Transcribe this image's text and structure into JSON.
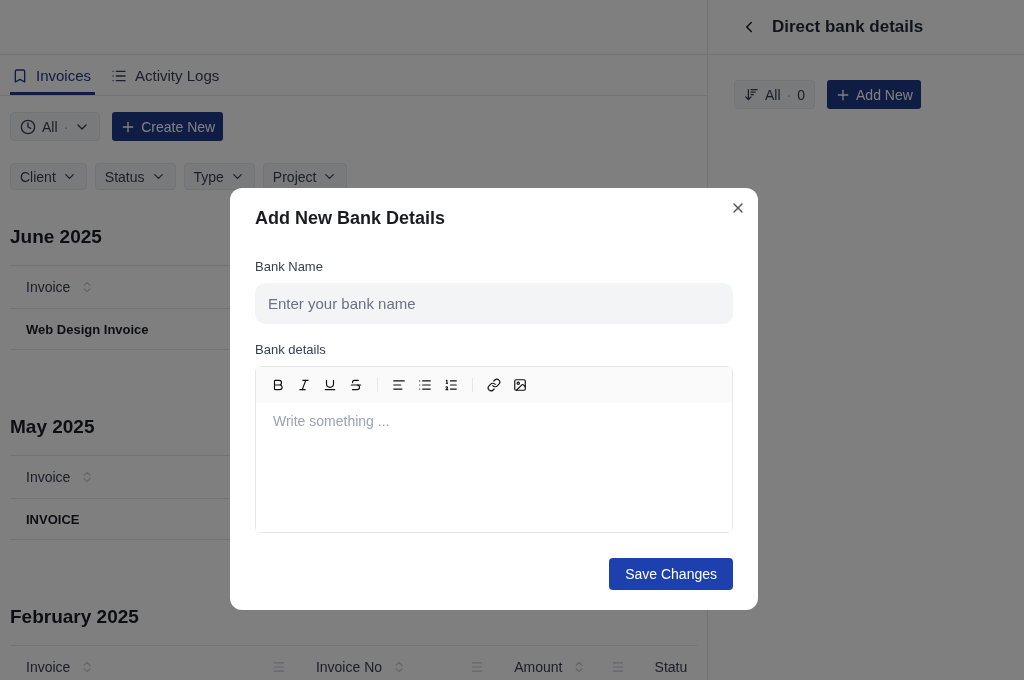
{
  "tabs": [
    {
      "label": "Invoices",
      "selected": true
    },
    {
      "label": "Activity Logs",
      "selected": false
    }
  ],
  "period_filter": {
    "label": "All",
    "separator": "·"
  },
  "create_button": {
    "label": "Create New"
  },
  "filters": [
    {
      "label": "Client"
    },
    {
      "label": "Status"
    },
    {
      "label": "Type"
    },
    {
      "label": "Project"
    }
  ],
  "sections": [
    {
      "title": "June 2025",
      "columns": [
        {
          "label": "Invoice"
        }
      ],
      "rows": [
        [
          "Web Design Invoice"
        ]
      ]
    },
    {
      "title": "May 2025",
      "columns": [
        {
          "label": "Invoice"
        }
      ],
      "rows": [
        [
          "INVOICE"
        ]
      ]
    },
    {
      "title": "February 2025",
      "columns": [
        {
          "label": "Invoice",
          "filter": true
        },
        {
          "label": "Invoice No",
          "filter": true
        },
        {
          "label": "Amount",
          "filter": true
        },
        {
          "label": "Statu",
          "filter": false
        }
      ]
    }
  ],
  "side_panel": {
    "title": "Direct bank details",
    "sort_filter": {
      "label": "All",
      "separator": "·",
      "count": "0"
    },
    "add_button": {
      "label": "Add New"
    }
  },
  "dialog": {
    "title": "Add New Bank Details",
    "fields": [
      {
        "kind": "input",
        "label": "Bank Name",
        "placeholder": "Enter your bank name"
      },
      {
        "kind": "editor",
        "label": "Bank details",
        "placeholder": "Write something ..."
      }
    ],
    "save_button": {
      "label": "Save Changes"
    }
  }
}
